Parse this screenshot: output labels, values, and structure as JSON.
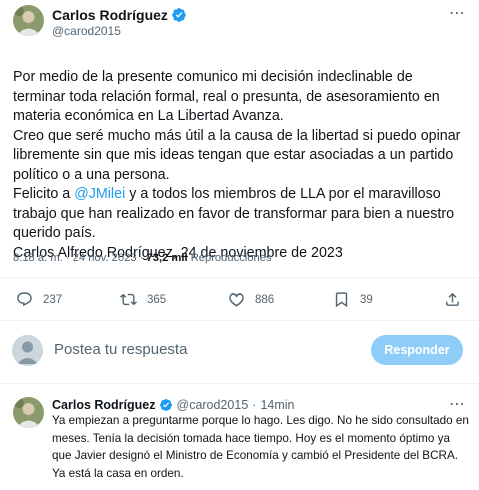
{
  "tweet": {
    "author_name": "Carlos Rodríguez",
    "author_handle": "@carod2015",
    "more_icon": "⋯",
    "paragraphs": [
      "Por medio de la presente comunico mi decisión indeclinable de terminar toda relación formal, real o presunta, de asesoramiento en materia económica en La Libertad Avanza.",
      "Creo que seré mucho más útil a la causa de la libertad si puedo opinar libremente sin que mis ideas tengan que estar asociadas a un partido político o a una persona."
    ],
    "paragraph3": {
      "before": "Felicito a ",
      "mention": "@JMilei",
      "after": " y a todos los miembros de LLA por el maravilloso trabajo que han realizado en favor de transformar para bien a nuestro querido país."
    },
    "signature": "Carlos Alfredo Rodríguez, 24 de noviembre de 2023",
    "time": "8:18 a. m.",
    "date": "24 nov. 2023",
    "views_count": "73,2 mil",
    "views_label": "Reproducciones",
    "stats": {
      "replies": "237",
      "retweets": "365",
      "likes": "886",
      "bookmarks": "39"
    }
  },
  "reply_box": {
    "placeholder": "Postea tu respuesta",
    "button_label": "Responder"
  },
  "reply": {
    "author_name": "Carlos Rodríguez",
    "author_handle": "@carod2015",
    "time_ago": "14min",
    "text": "Ya empiezan a preguntarme porque lo hago. Les digo. No he sido consultado en meses. Tenía la decisión tomada hace tiempo. Hoy es el momento óptimo ya que Javier designó el Ministro de Economía y cambió el Presidente del BCRA. Ya está la casa en orden."
  },
  "colors": {
    "accent": "#1d9bf0",
    "text_primary": "#0f1419",
    "text_secondary": "#536471",
    "button_disabled": "#8ecdf7"
  },
  "icons": {
    "verified": "verified-badge-icon",
    "reply": "reply-icon",
    "retweet": "retweet-icon",
    "like": "heart-icon",
    "bookmark": "bookmark-icon",
    "share": "share-icon",
    "more": "more-dots-icon"
  }
}
